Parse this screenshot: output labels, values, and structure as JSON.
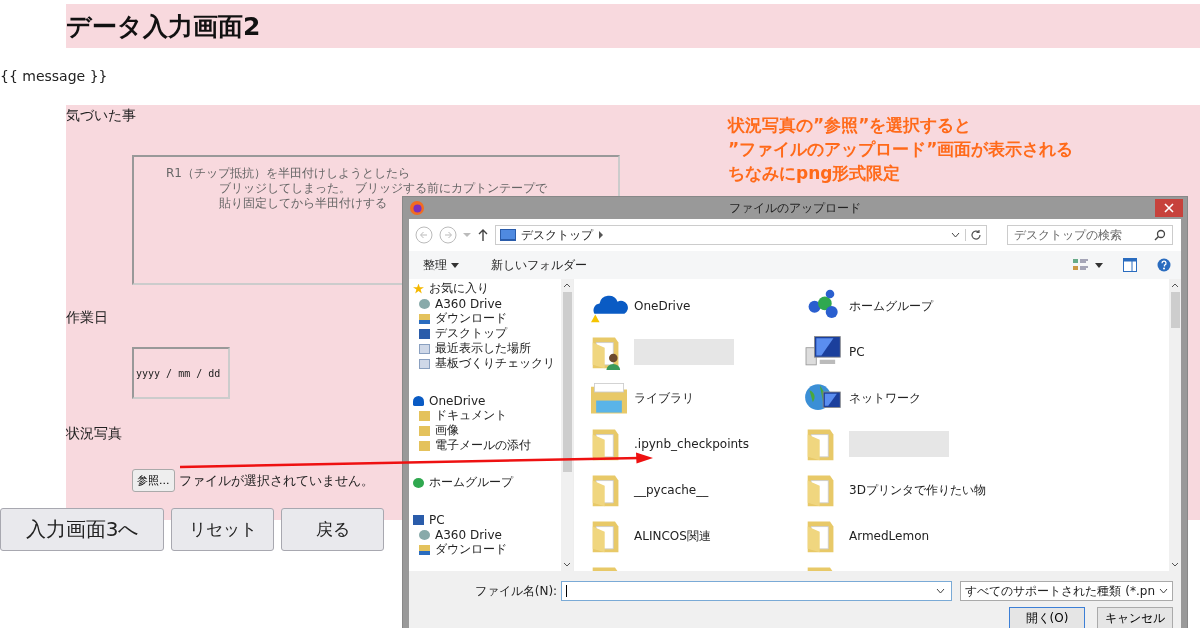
{
  "page": {
    "title": "データ入力画面2",
    "message": "{{ message }}"
  },
  "form": {
    "fields": [
      {
        "kind": "textarea",
        "label": "気づいた事",
        "placeholder_lines": [
          "R1（チップ抵抗）を半田付けしようとしたら",
          "ブリッジしてしまった。 ブリッジする前にカプトンテープで",
          "貼り固定してから半田付けする"
        ]
      },
      {
        "kind": "date",
        "label": "作業日",
        "placeholder": "yyyy / mm / dd"
      },
      {
        "kind": "file",
        "label": "状況写真",
        "button": "参照...",
        "status": "ファイルが選択されていません。"
      }
    ]
  },
  "buttons": [
    "入力画面3へ",
    "リセット",
    "戻る"
  ],
  "annotation": {
    "lines": [
      "状況写真の”参照”を選択すると",
      "”ファイルのアップロード”画面が表示される",
      "ちなみにpng形式限定"
    ]
  },
  "dialog": {
    "title": "ファイルのアップロード",
    "address": "デスクトップ",
    "search_placeholder": "デスクトップの検索",
    "toolbar": [
      {
        "label": "整理",
        "menu": true
      },
      {
        "label": "新しいフォルダー",
        "menu": false
      }
    ],
    "nav": [
      {
        "label": "お気に入り",
        "kind": "star",
        "children": [
          {
            "label": "A360 Drive",
            "kind": "drive"
          },
          {
            "label": "ダウンロード",
            "kind": "download"
          },
          {
            "label": "デスクトップ",
            "kind": "desktop"
          },
          {
            "label": "最近表示した場所",
            "kind": "recent"
          },
          {
            "label": "基板づくりチェックリ",
            "kind": "doc"
          }
        ]
      },
      {
        "label": "OneDrive",
        "kind": "cloud",
        "children": [
          {
            "label": "ドキュメント",
            "kind": "folder"
          },
          {
            "label": "画像",
            "kind": "folder"
          },
          {
            "label": "電子メールの添付",
            "kind": "folder"
          }
        ]
      },
      {
        "label": "ホームグループ",
        "kind": "homegroup"
      },
      {
        "label": "PC",
        "kind": "pc",
        "children": [
          {
            "label": "A360 Drive",
            "kind": "drive"
          },
          {
            "label": "ダウンロード",
            "kind": "download"
          }
        ]
      }
    ],
    "items": [
      {
        "name": "OneDrive",
        "kind": "cloud",
        "redacted": false
      },
      {
        "name": "ホームグループ",
        "kind": "homegroup",
        "redacted": false
      },
      {
        "kind": "user-folder",
        "redacted": true
      },
      {
        "name": "PC",
        "kind": "pc",
        "redacted": false
      },
      {
        "name": "ライブラリ",
        "kind": "library",
        "redacted": false
      },
      {
        "name": "ネットワーク",
        "kind": "network",
        "redacted": false
      },
      {
        "name": ".ipynb_checkpoints",
        "kind": "folder",
        "redacted": false
      },
      {
        "kind": "folder",
        "redacted": true
      },
      {
        "name": "__pycache__",
        "kind": "folder",
        "redacted": false
      },
      {
        "name": "3Dプリンタで作りたい物",
        "kind": "folder",
        "redacted": false
      },
      {
        "name": "ALINCOS関連",
        "kind": "folder",
        "redacted": false
      },
      {
        "name": "ArmedLemon",
        "kind": "folder",
        "redacted": false
      },
      {
        "kind": "folder",
        "redacted": false
      },
      {
        "kind": "folder",
        "redacted": false
      }
    ],
    "filename_label": "ファイル名(N):",
    "filter": "すべてのサポートされた種類 (*.pn",
    "buttons": [
      {
        "label": "開く(O)",
        "default": true
      },
      {
        "label": "キャンセル",
        "default": false
      }
    ]
  }
}
